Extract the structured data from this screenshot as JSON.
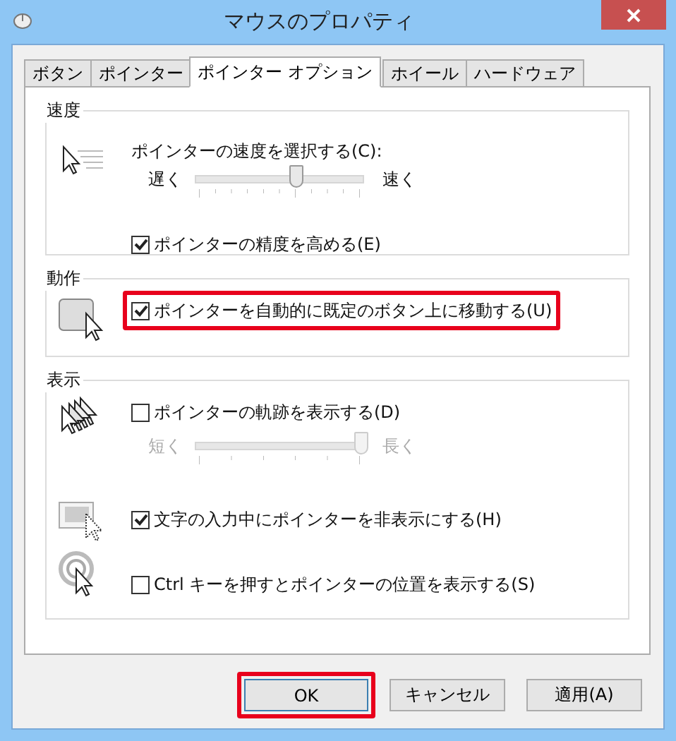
{
  "window": {
    "title": "マウスのプロパティ"
  },
  "tabs": [
    {
      "label": "ボタン",
      "selected": false
    },
    {
      "label": "ポインター",
      "selected": false
    },
    {
      "label": "ポインター オプション",
      "selected": true
    },
    {
      "label": "ホイール",
      "selected": false
    },
    {
      "label": "ハードウェア",
      "selected": false
    }
  ],
  "groups": [
    {
      "title": "速度",
      "rows": [
        {
          "items": [
            {
              "kind": "label",
              "text": "ポインターの速度を選択する(C):"
            },
            {
              "kind": "slider",
              "low": "遅く",
              "high": "速く",
              "level": 0.6,
              "disabled": false
            },
            {
              "kind": "checkbox",
              "label": "ポインターの精度を高める(E)",
              "checked": true,
              "highlighted": false
            }
          ]
        }
      ]
    },
    {
      "title": "動作",
      "rows": [
        {
          "items": [
            {
              "kind": "checkbox",
              "label": "ポインターを自動的に既定のボタン上に移動する(U)",
              "checked": true,
              "highlighted": true
            }
          ]
        }
      ]
    },
    {
      "title": "表示",
      "rows": [
        {
          "items": [
            {
              "kind": "checkbox",
              "label": "ポインターの軌跡を表示する(D)",
              "checked": false,
              "highlighted": false
            },
            {
              "kind": "slider",
              "low": "短く",
              "high": "長く",
              "level": 1,
              "disabled": true
            }
          ]
        },
        {
          "items": [
            {
              "kind": "checkbox",
              "label": "文字の入力中にポインターを非表示にする(H)",
              "checked": true,
              "highlighted": false
            }
          ]
        },
        {
          "items": [
            {
              "kind": "checkbox",
              "label": "Ctrl キーを押すとポインターの位置を表示する(S)",
              "checked": false,
              "highlighted": false
            }
          ]
        }
      ]
    }
  ],
  "buttons": [
    {
      "label": "OK",
      "default": true,
      "highlighted": true
    },
    {
      "label": "キャンセル",
      "default": false,
      "highlighted": false
    },
    {
      "label": "適用(A)",
      "default": false,
      "highlighted": false
    }
  ]
}
